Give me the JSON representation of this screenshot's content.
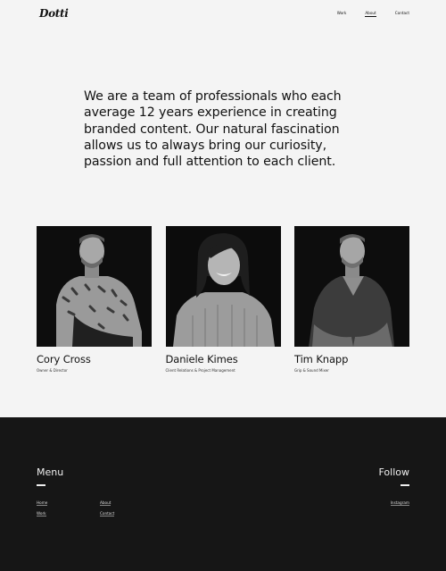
{
  "header": {
    "logo": "Dotti",
    "nav": [
      {
        "label": "Work"
      },
      {
        "label": "About",
        "active": true
      },
      {
        "label": "Contact"
      }
    ]
  },
  "intro": {
    "text": "We are a team of professionals who each average 12 years experience in creating branded content. Our natural fascination allows us to always bring our curiosity, passion and full attention to each client."
  },
  "team": [
    {
      "name": "Cory Cross",
      "role": "Owner & Director"
    },
    {
      "name": "Daniele Kimes",
      "role": "Client Relations & Project Management"
    },
    {
      "name": "Tim Knapp",
      "role": "Grip & Sound Mixer"
    }
  ],
  "footer": {
    "menu_title": "Menu",
    "follow_title": "Follow",
    "links": {
      "home": "Home",
      "about": "About",
      "work": "Work",
      "contact": "Contact",
      "instagram": "Instagram"
    }
  },
  "colors": {
    "page_bg": "#f4f4f4",
    "footer_bg": "#161616",
    "text": "#111111"
  }
}
